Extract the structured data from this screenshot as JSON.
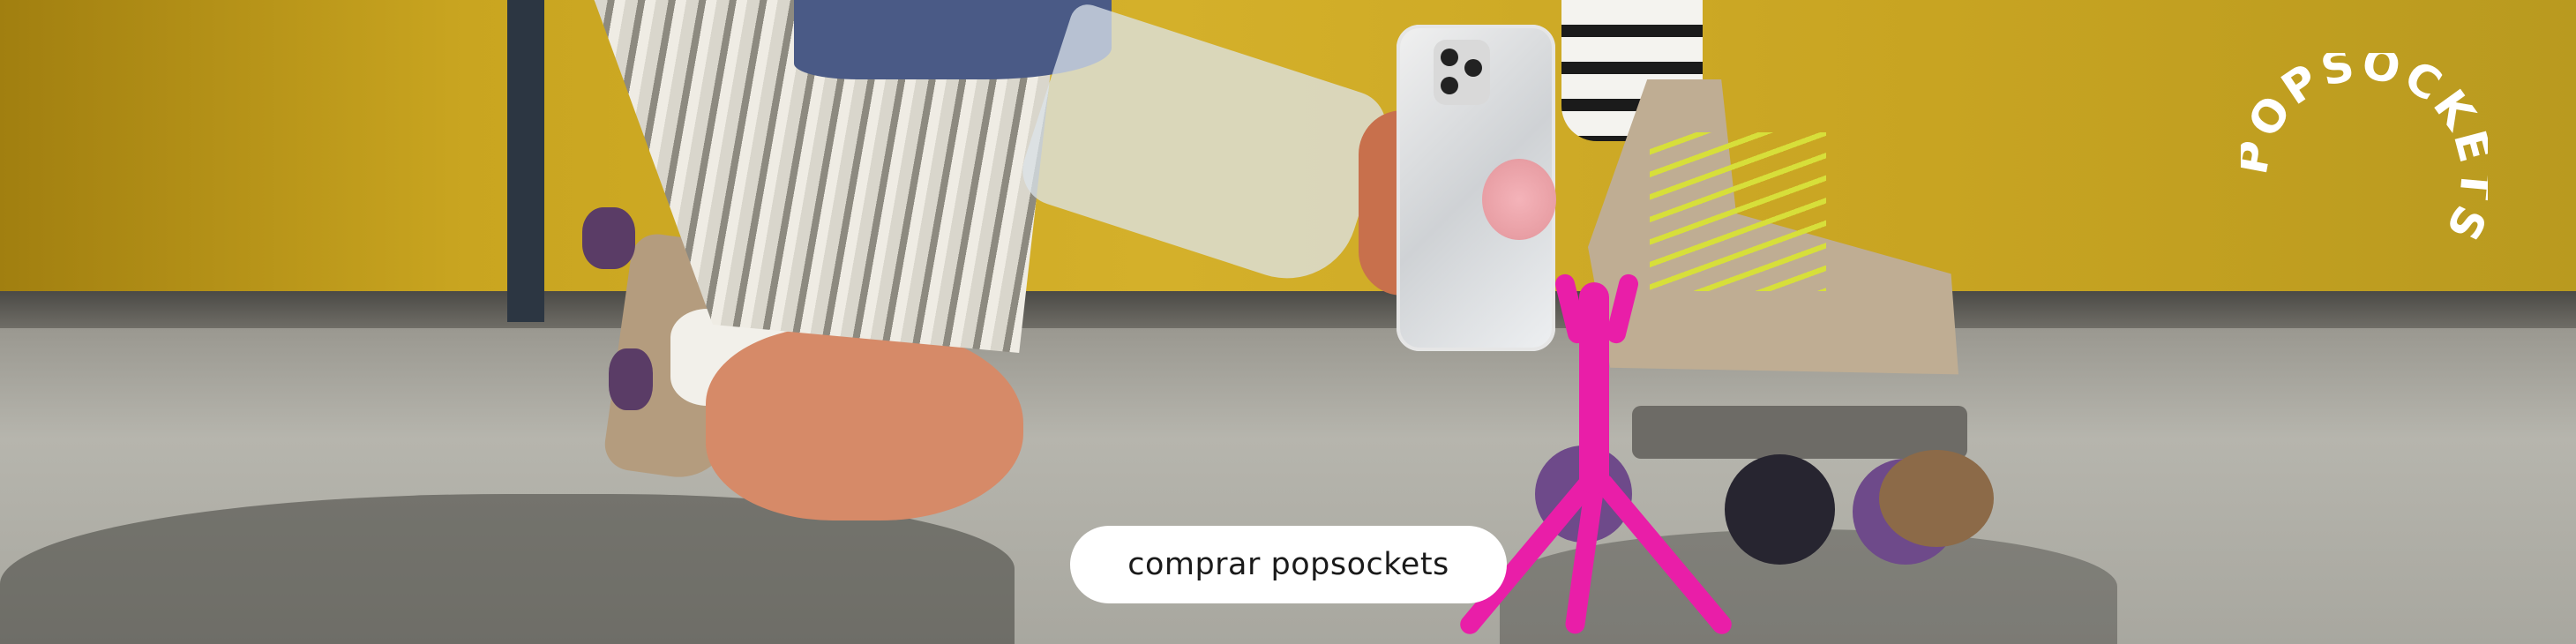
{
  "banner": {
    "cta_label": "comprar popsockets",
    "brand_wordmark": "POPSOCKETS"
  },
  "colors": {
    "wall": "#c9a520",
    "floor": "#b4b3ab",
    "tripod": "#e91ea8",
    "cta_bg": "#ffffff",
    "cta_text": "#1a1a1a",
    "logo": "#ffffff"
  }
}
